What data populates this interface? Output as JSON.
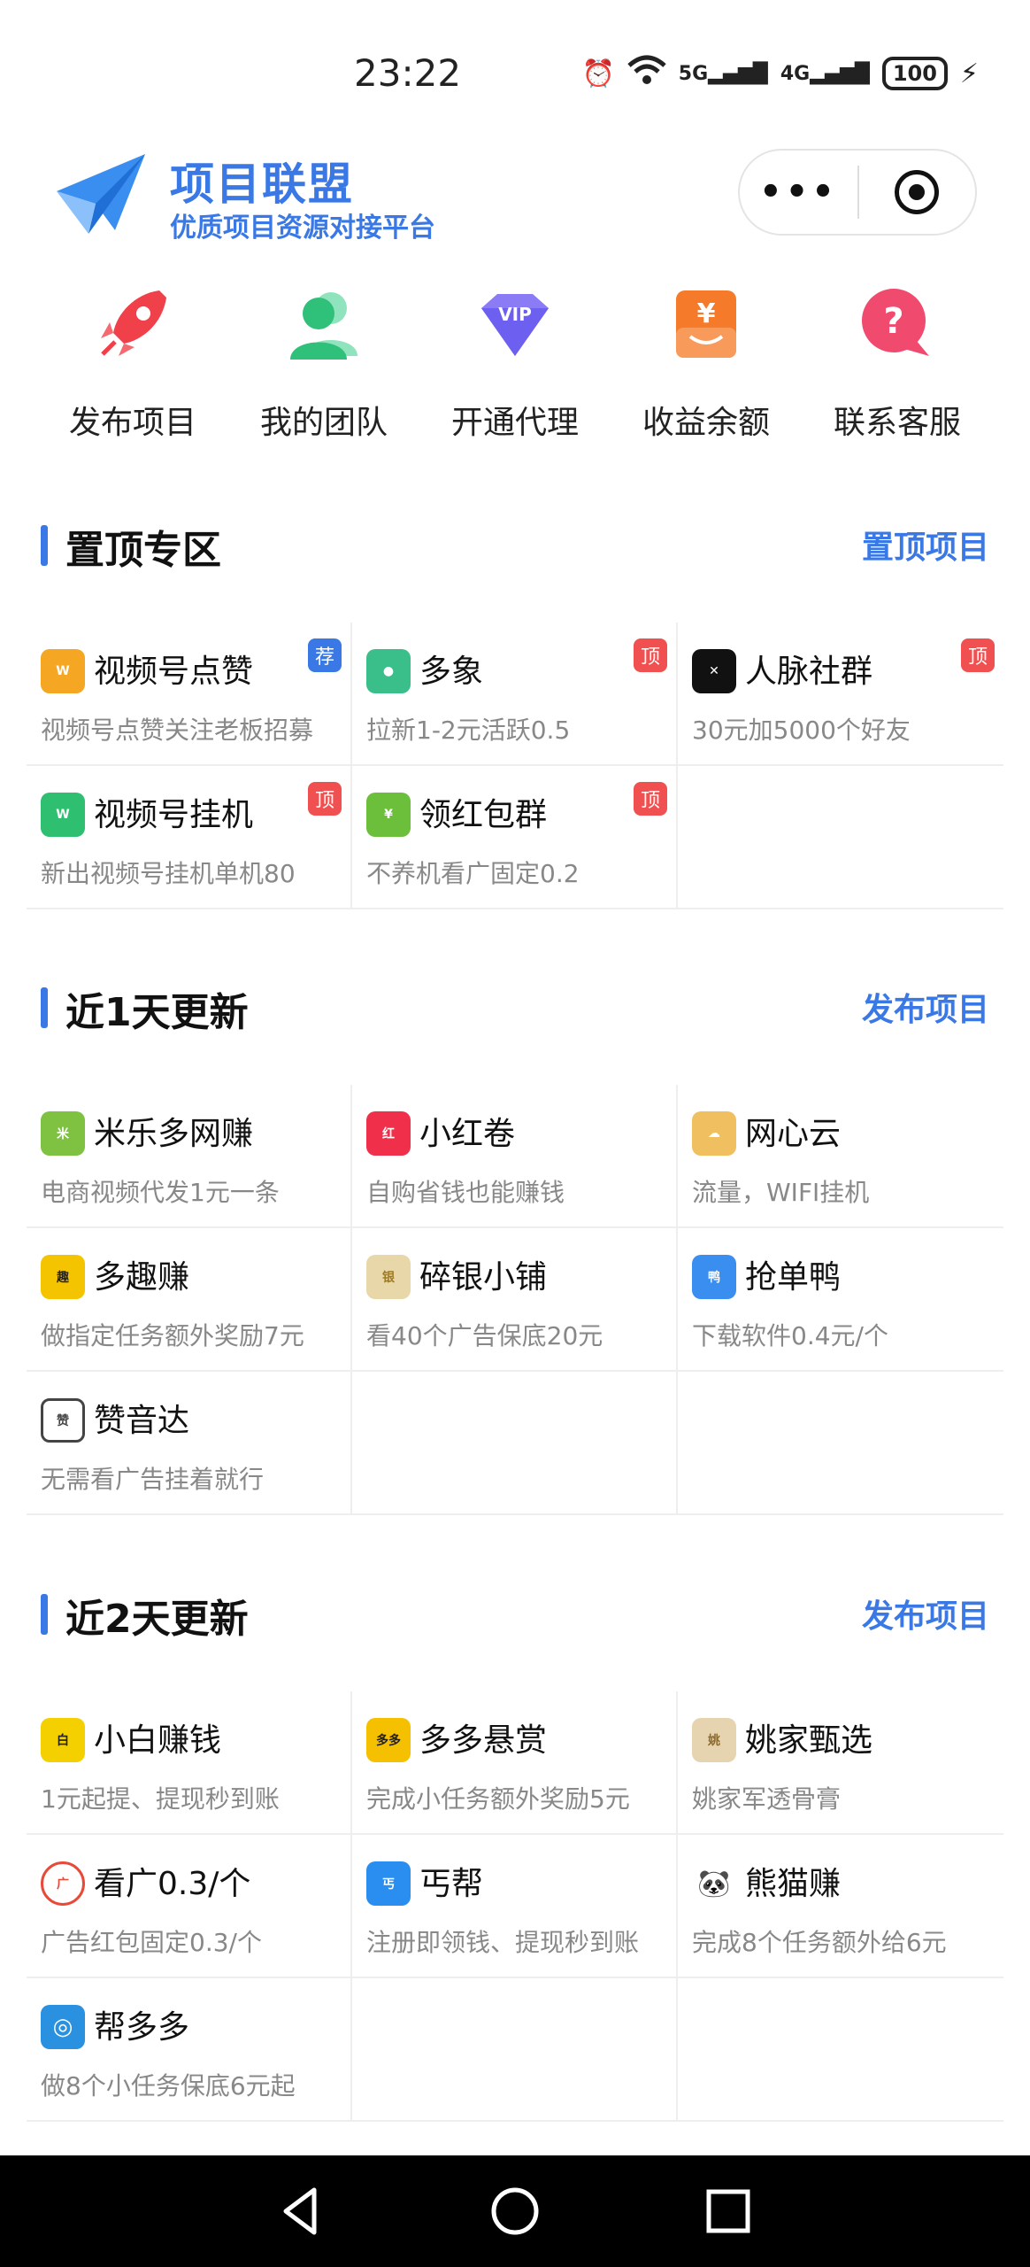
{
  "status_bar": {
    "time": "23:22",
    "signal_5g": "5G",
    "signal_4g": "4G",
    "battery": "100"
  },
  "header": {
    "title": "项目联盟",
    "subtitle": "优质项目资源对接平台",
    "capsule_more": "•••"
  },
  "quick_nav": [
    {
      "label": "发布项目",
      "icon": "rocket-icon",
      "color": "#f0404a"
    },
    {
      "label": "我的团队",
      "icon": "team-icon",
      "color": "#2fc07a"
    },
    {
      "label": "开通代理",
      "icon": "vip-icon",
      "color": "#7a6cf0"
    },
    {
      "label": "收益余额",
      "icon": "wallet-icon",
      "color": "#f57a2a"
    },
    {
      "label": "联系客服",
      "icon": "help-icon",
      "color": "#f04a6e"
    }
  ],
  "sections": [
    {
      "title": "置顶专区",
      "link": "置顶项目",
      "items": [
        {
          "name": "视频号点赞",
          "desc": "视频号点赞关注老板招募",
          "badge": "荐",
          "badge_type": "rec",
          "logo_color": "#f5a623"
        },
        {
          "name": "多象",
          "desc": "拉新1-2元活跃0.5",
          "badge": "顶",
          "badge_type": "top",
          "logo_color": "#3bbf8a"
        },
        {
          "name": "人脉社群",
          "desc": "30元加5000个好友",
          "badge": "顶",
          "badge_type": "top",
          "logo_color": "#111111"
        },
        {
          "name": "视频号挂机",
          "desc": "新出视频号挂机单机80",
          "badge": "顶",
          "badge_type": "top",
          "logo_color": "#2fbf71"
        },
        {
          "name": "领红包群",
          "desc": "不养机看广固定0.2",
          "badge": "顶",
          "badge_type": "top",
          "logo_color": "#6bbf3a"
        }
      ]
    },
    {
      "title": "近1天更新",
      "link": "发布项目",
      "items": [
        {
          "name": "米乐多网赚",
          "desc": "电商视频代发1元一条",
          "logo_color": "#7fc241"
        },
        {
          "name": "小红卷",
          "desc": "自购省钱也能赚钱",
          "logo_color": "#f0304a"
        },
        {
          "name": "网心云",
          "desc": "流量，WIFI挂机",
          "logo_color": "#f0c060"
        },
        {
          "name": "多趣赚",
          "desc": "做指定任务额外奖励7元",
          "logo_color": "#f5c400"
        },
        {
          "name": "碎银小铺",
          "desc": "看40个广告保底20元",
          "logo_color": "#e8d7a8"
        },
        {
          "name": "抢单鸭",
          "desc": "下载软件0.4元/个",
          "logo_color": "#3a8ef0"
        },
        {
          "name": "赞音达",
          "desc": "无需看广告挂着就行",
          "logo_color": "#444444"
        }
      ]
    },
    {
      "title": "近2天更新",
      "link": "发布项目",
      "items": [
        {
          "name": "小白赚钱",
          "desc": "1元起提、提现秒到账",
          "logo_color": "#f5d000"
        },
        {
          "name": "多多悬赏",
          "desc": "完成小任务额外奖励5元",
          "logo_color": "#f5c000"
        },
        {
          "name": "姚家甄选",
          "desc": "姚家军透骨膏",
          "logo_color": "#e6d3b0"
        },
        {
          "name": "看广0.3/个",
          "desc": "广告红包固定0.3/个",
          "logo_color": "#e84a3a"
        },
        {
          "name": "丐帮",
          "desc": "注册即领钱、提现秒到账",
          "logo_color": "#2a8ef0"
        },
        {
          "name": "熊猫赚",
          "desc": "完成8个任务额外给6元",
          "logo_color": "#333333"
        },
        {
          "name": "帮多多",
          "desc": "做8个小任务保底6元起",
          "logo_color": "#2a90e0"
        }
      ]
    }
  ]
}
